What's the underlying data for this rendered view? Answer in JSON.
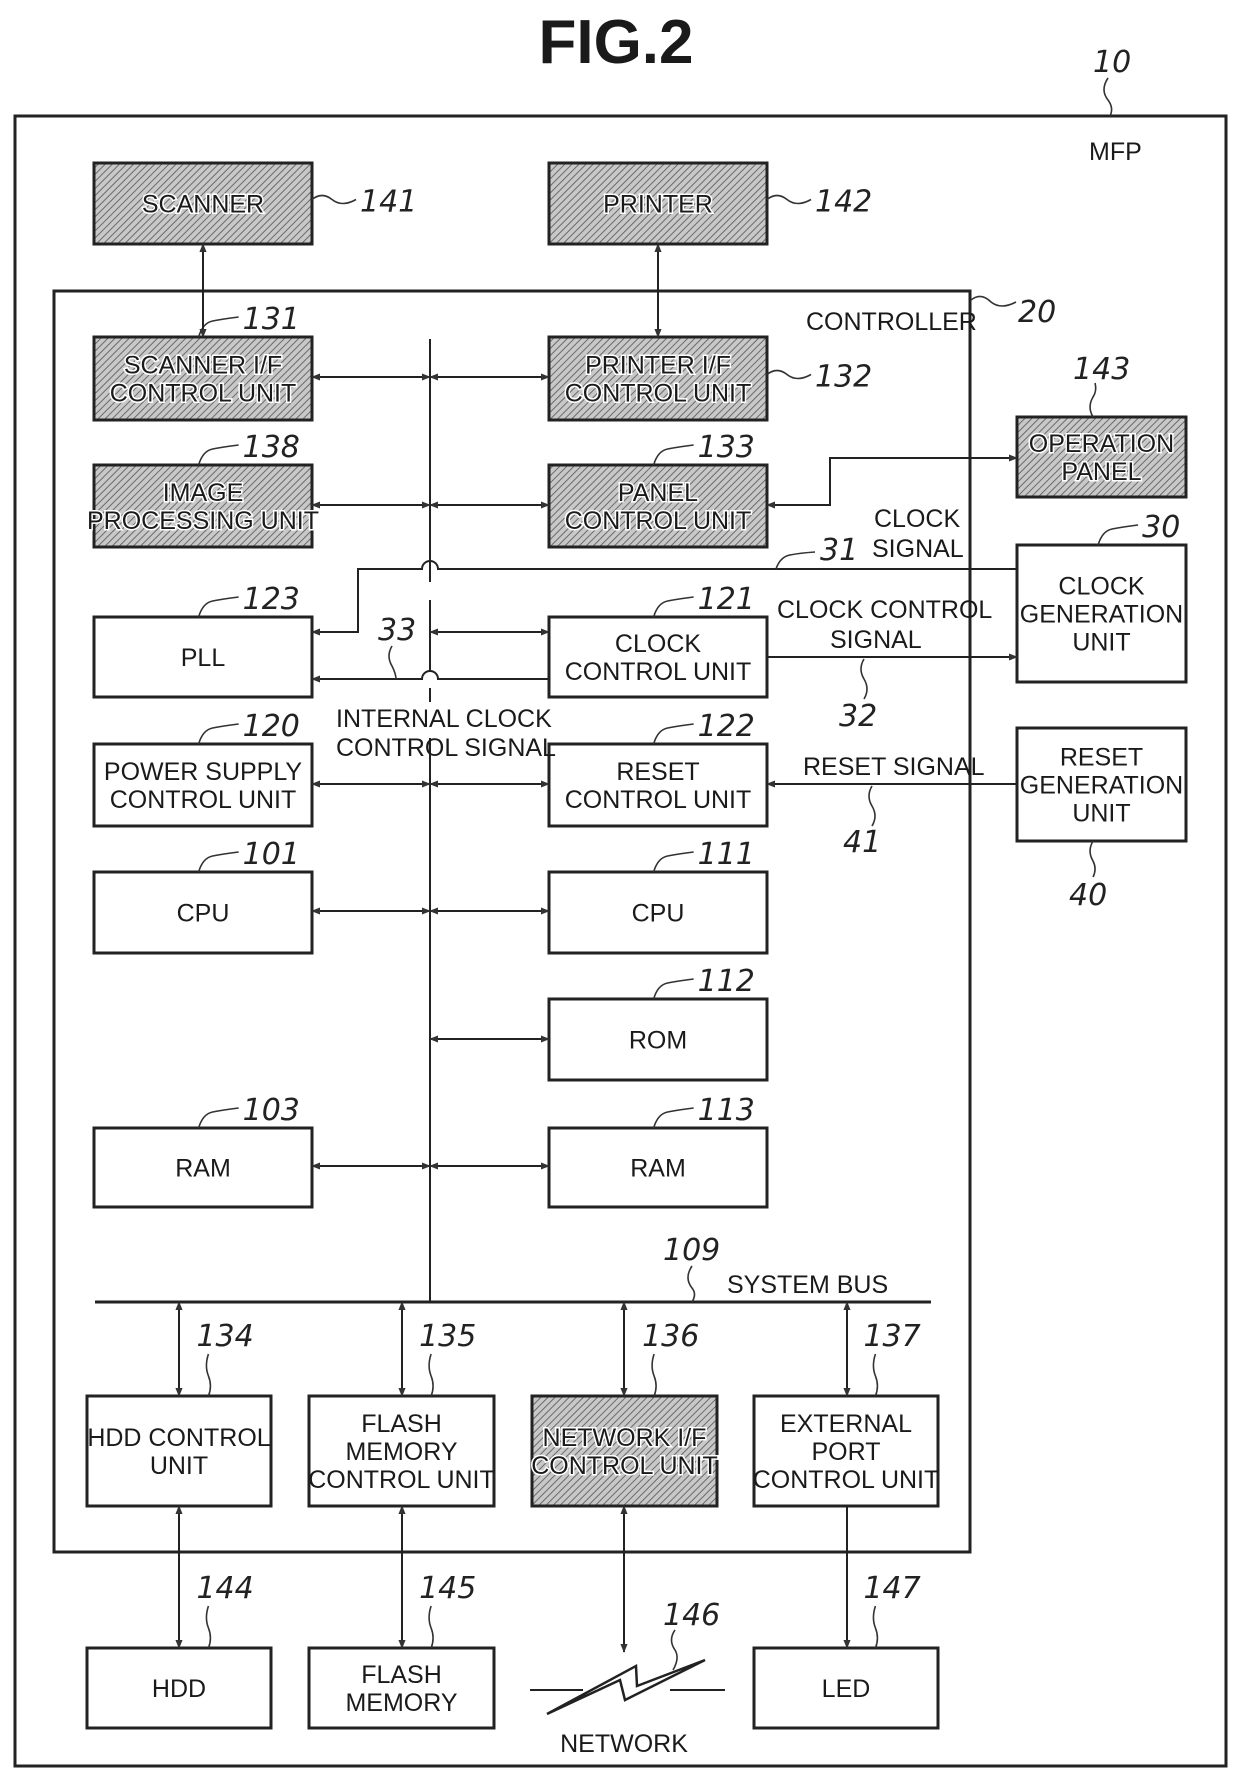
{
  "figure": {
    "title": "FIG.2",
    "mfp": {
      "label": "MFP",
      "ref": "10"
    },
    "controller": {
      "label": "CONTROLLER",
      "ref": "20"
    },
    "system_bus": {
      "label": "SYSTEM BUS",
      "ref": "109"
    },
    "internal_bus_label": [
      "INTERNAL CLOCK",
      "CONTROL SIGNAL"
    ],
    "signals": {
      "clock_signal": {
        "lines": [
          "CLOCK",
          "SIGNAL"
        ],
        "ref": "31"
      },
      "clock_control_signal": {
        "lines": [
          "CLOCK CONTROL",
          "SIGNAL"
        ],
        "ref": "32"
      },
      "internal_clock_control_signal": {
        "ref": "33"
      },
      "reset_signal": {
        "lines": [
          "RESET SIGNAL"
        ],
        "ref": "41"
      }
    },
    "blocks": [
      {
        "id": "scanner",
        "lines": [
          "SCANNER"
        ],
        "ref": "141",
        "shaded": true
      },
      {
        "id": "printer",
        "lines": [
          "PRINTER"
        ],
        "ref": "142",
        "shaded": true
      },
      {
        "id": "scanner-if",
        "lines": [
          "SCANNER I/F",
          "CONTROL UNIT"
        ],
        "ref": "131",
        "shaded": true
      },
      {
        "id": "printer-if",
        "lines": [
          "PRINTER I/F",
          "CONTROL UNIT"
        ],
        "ref": "132",
        "shaded": true
      },
      {
        "id": "image-processing",
        "lines": [
          "IMAGE",
          "PROCESSING UNIT"
        ],
        "ref": "138",
        "shaded": true
      },
      {
        "id": "panel-control",
        "lines": [
          "PANEL",
          "CONTROL UNIT"
        ],
        "ref": "133",
        "shaded": true
      },
      {
        "id": "operation-panel",
        "lines": [
          "OPERATION",
          "PANEL"
        ],
        "ref": "143",
        "shaded": true
      },
      {
        "id": "pll",
        "lines": [
          "PLL"
        ],
        "ref": "123",
        "shaded": false
      },
      {
        "id": "clock-control",
        "lines": [
          "CLOCK",
          "CONTROL UNIT"
        ],
        "ref": "121",
        "shaded": false
      },
      {
        "id": "clock-generation",
        "lines": [
          "CLOCK",
          "GENERATION",
          "UNIT"
        ],
        "ref": "30",
        "shaded": false
      },
      {
        "id": "power-supply",
        "lines": [
          "POWER SUPPLY",
          "CONTROL UNIT"
        ],
        "ref": "120",
        "shaded": false
      },
      {
        "id": "reset-control",
        "lines": [
          "RESET",
          "CONTROL UNIT"
        ],
        "ref": "122",
        "shaded": false
      },
      {
        "id": "reset-generation",
        "lines": [
          "RESET",
          "GENERATION",
          "UNIT"
        ],
        "ref": "40",
        "shaded": false
      },
      {
        "id": "cpu-101",
        "lines": [
          "CPU"
        ],
        "ref": "101",
        "shaded": false
      },
      {
        "id": "cpu-111",
        "lines": [
          "CPU"
        ],
        "ref": "111",
        "shaded": false
      },
      {
        "id": "rom",
        "lines": [
          "ROM"
        ],
        "ref": "112",
        "shaded": false
      },
      {
        "id": "ram-103",
        "lines": [
          "RAM"
        ],
        "ref": "103",
        "shaded": false
      },
      {
        "id": "ram-113",
        "lines": [
          "RAM"
        ],
        "ref": "113",
        "shaded": false
      },
      {
        "id": "hdd-control",
        "lines": [
          "HDD CONTROL",
          "UNIT"
        ],
        "ref": "134",
        "shaded": false
      },
      {
        "id": "flash-control",
        "lines": [
          "FLASH",
          "MEMORY",
          "CONTROL UNIT"
        ],
        "ref": "135",
        "shaded": false
      },
      {
        "id": "network-if",
        "lines": [
          "NETWORK I/F",
          "CONTROL UNIT"
        ],
        "ref": "136",
        "shaded": true
      },
      {
        "id": "external-port",
        "lines": [
          "EXTERNAL",
          "PORT",
          "CONTROL UNIT"
        ],
        "ref": "137",
        "shaded": false
      },
      {
        "id": "hdd",
        "lines": [
          "HDD"
        ],
        "ref": "144",
        "shaded": false
      },
      {
        "id": "flash-memory",
        "lines": [
          "FLASH",
          "MEMORY"
        ],
        "ref": "145",
        "shaded": false
      },
      {
        "id": "led",
        "lines": [
          "LED"
        ],
        "ref": "147",
        "shaded": false
      }
    ],
    "network": {
      "label": "NETWORK",
      "ref": "146"
    },
    "colors": {
      "ink": "#1a1a1a",
      "shade": "#9a9a9a",
      "background": "#ffffff"
    }
  }
}
